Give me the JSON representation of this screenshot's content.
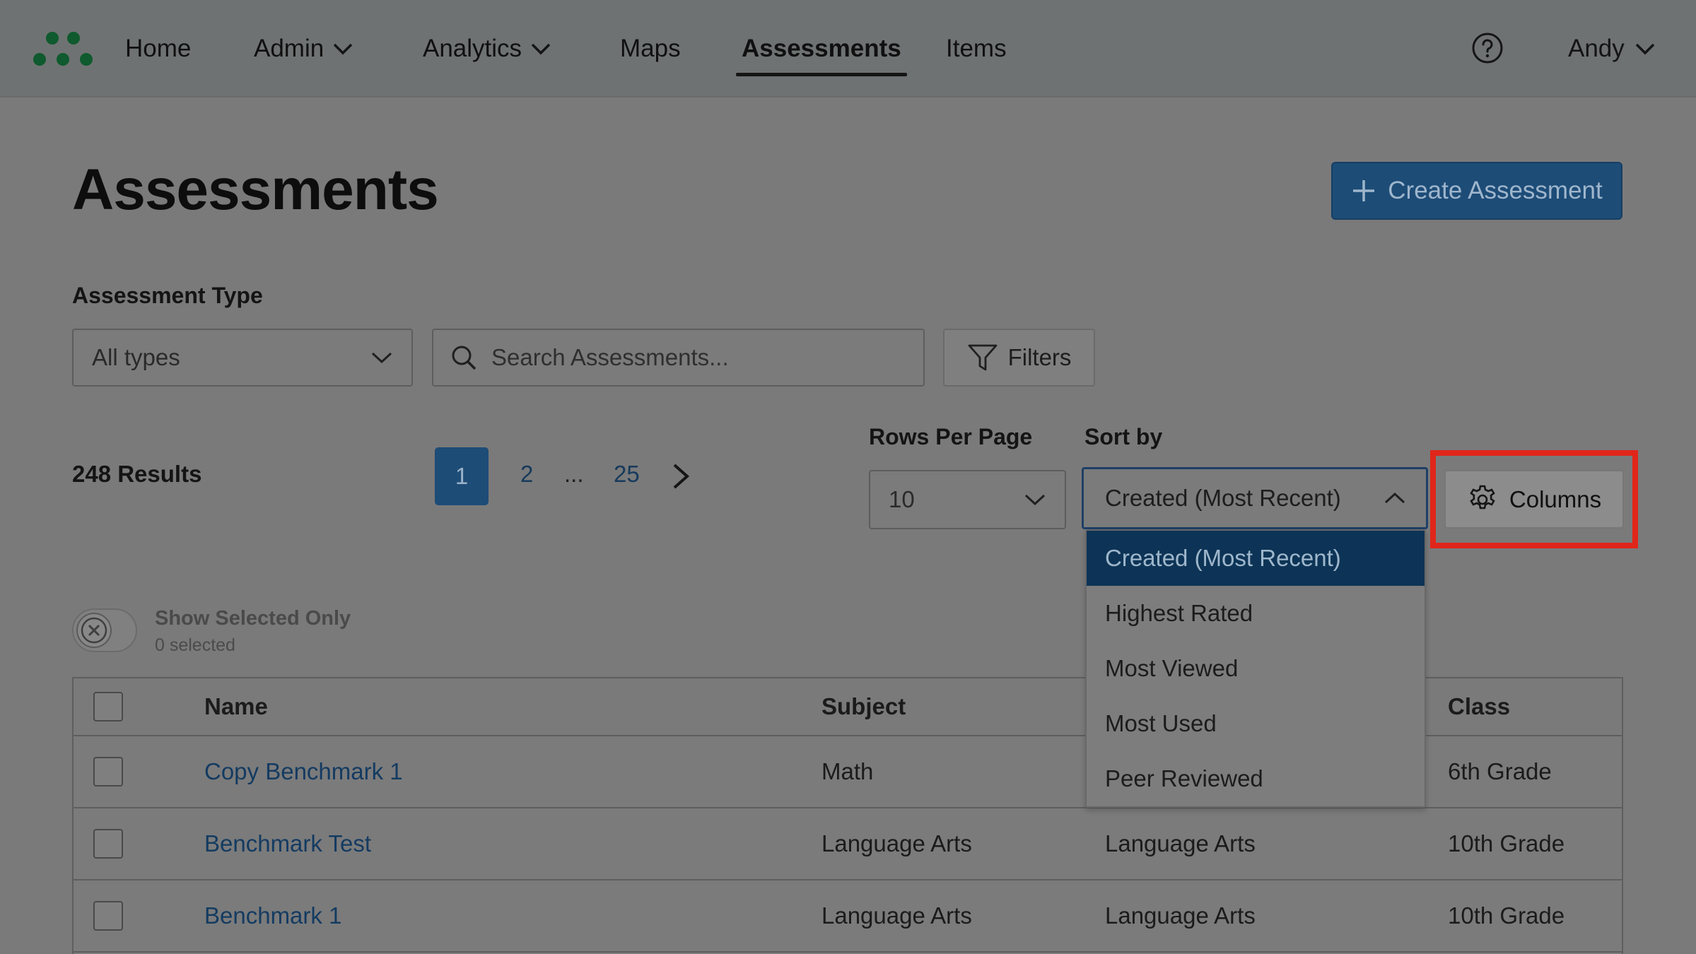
{
  "nav": {
    "items": [
      {
        "label": "Home"
      },
      {
        "label": "Admin"
      },
      {
        "label": "Analytics"
      },
      {
        "label": "Maps"
      },
      {
        "label": "Assessments"
      },
      {
        "label": "Items"
      }
    ],
    "user": "Andy"
  },
  "page": {
    "title": "Assessments",
    "create_button": "Create Assessment"
  },
  "filters": {
    "type_label": "Assessment Type",
    "type_value": "All types",
    "search_placeholder": "Search Assessments...",
    "filters_button": "Filters"
  },
  "results": {
    "count_text": "248 Results",
    "pages": [
      "1",
      "2",
      "...",
      "25"
    ],
    "current_page": "1"
  },
  "rows_per_page": {
    "label": "Rows Per Page",
    "value": "10"
  },
  "sort": {
    "label": "Sort by",
    "value": "Created (Most Recent)",
    "options": [
      "Created (Most Recent)",
      "Highest Rated",
      "Most Viewed",
      "Most Used",
      "Peer Reviewed"
    ]
  },
  "columns_button": "Columns",
  "selection": {
    "toggle_label": "Show Selected Only",
    "count_text": "0 selected"
  },
  "table": {
    "headers": [
      "Name",
      "Subject",
      "",
      "Class"
    ],
    "rows": [
      {
        "name": "Copy Benchmark 1",
        "subject": "Math",
        "col3": "",
        "class": "6th Grade"
      },
      {
        "name": "Benchmark Test",
        "subject": "Language Arts",
        "col3": "Language Arts",
        "class": "10th Grade"
      },
      {
        "name": "Benchmark 1",
        "subject": "Language Arts",
        "col3": "Language Arts",
        "class": "10th Grade"
      }
    ]
  },
  "colors": {
    "primary": "#1d4c77",
    "highlight": "#e0261a",
    "selected_option": "#0d3456",
    "logo": "#0f5a2e"
  }
}
